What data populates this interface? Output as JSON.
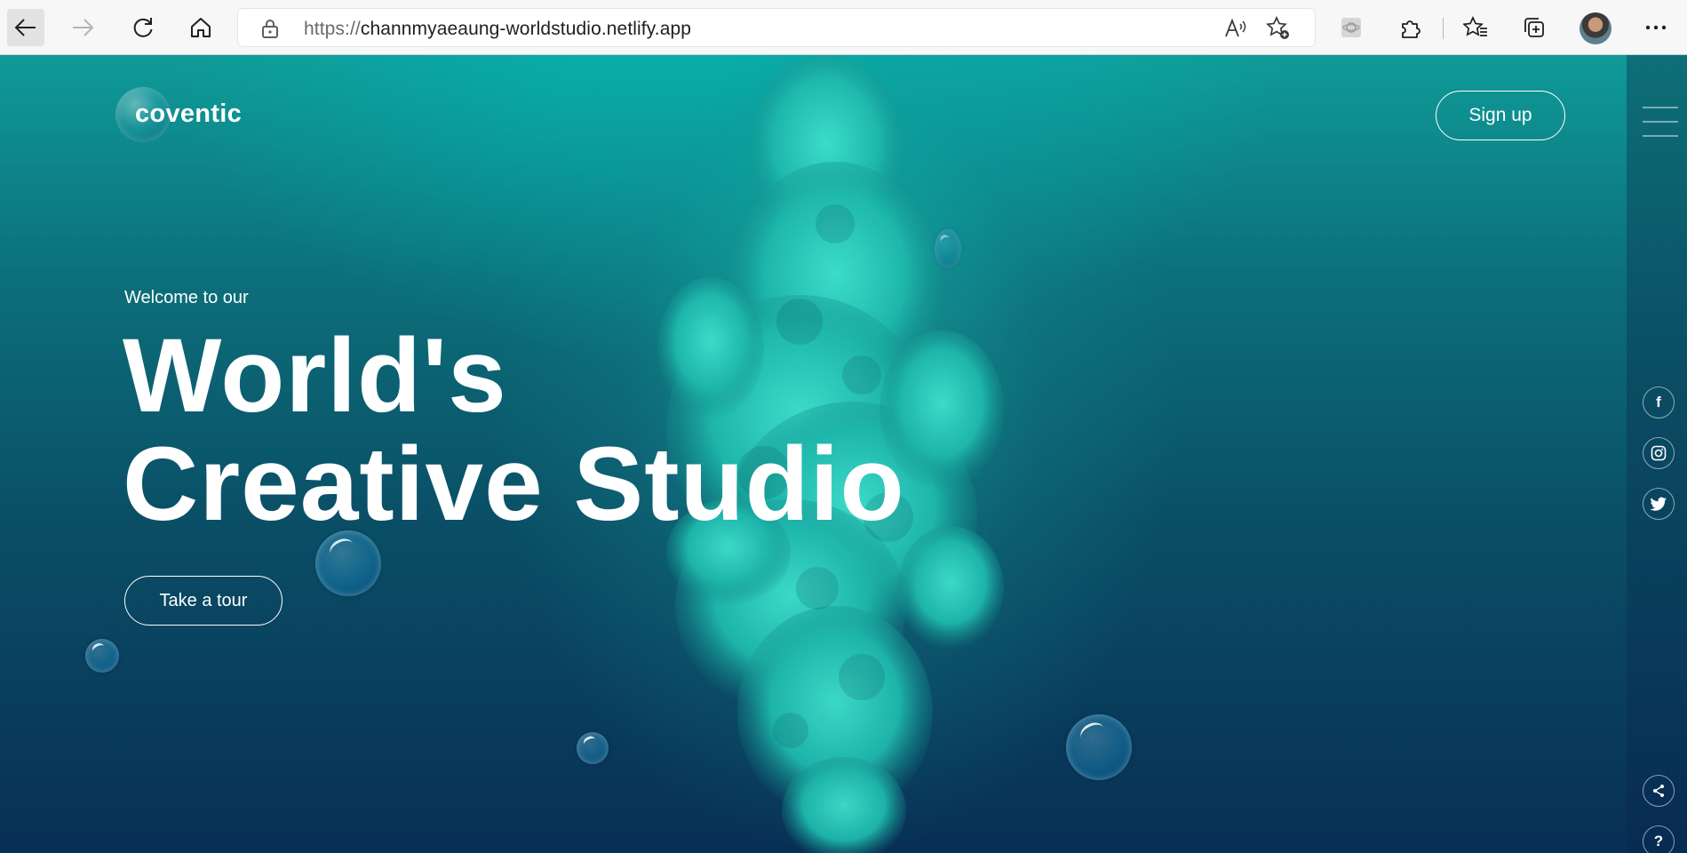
{
  "browser": {
    "url_protocol": "https://",
    "url_host": "channmyaeaung-worldstudio.netlify.app",
    "icons": [
      "back-icon",
      "forward-icon",
      "refresh-icon",
      "home-icon",
      "lock-icon",
      "read-aloud-icon",
      "add-favorite-icon",
      "extension-icon",
      "puzzle-icon",
      "favorites-icon",
      "collections-icon",
      "more-icon"
    ]
  },
  "site": {
    "logo": "coventic",
    "signup_label": "Sign up",
    "welcome": "Welcome to our",
    "headline_line1": "World's",
    "headline_line2": "Creative Studio",
    "tour_label": "Take a tour"
  },
  "rail": {
    "facebook": "f",
    "help": "?",
    "icons": [
      "menu-icon",
      "facebook-icon",
      "instagram-icon",
      "twitter-icon",
      "share-icon",
      "help-icon"
    ]
  },
  "colors": {
    "accent": "#1ec8b4",
    "text": "#ffffff",
    "deep": "#082f55"
  }
}
